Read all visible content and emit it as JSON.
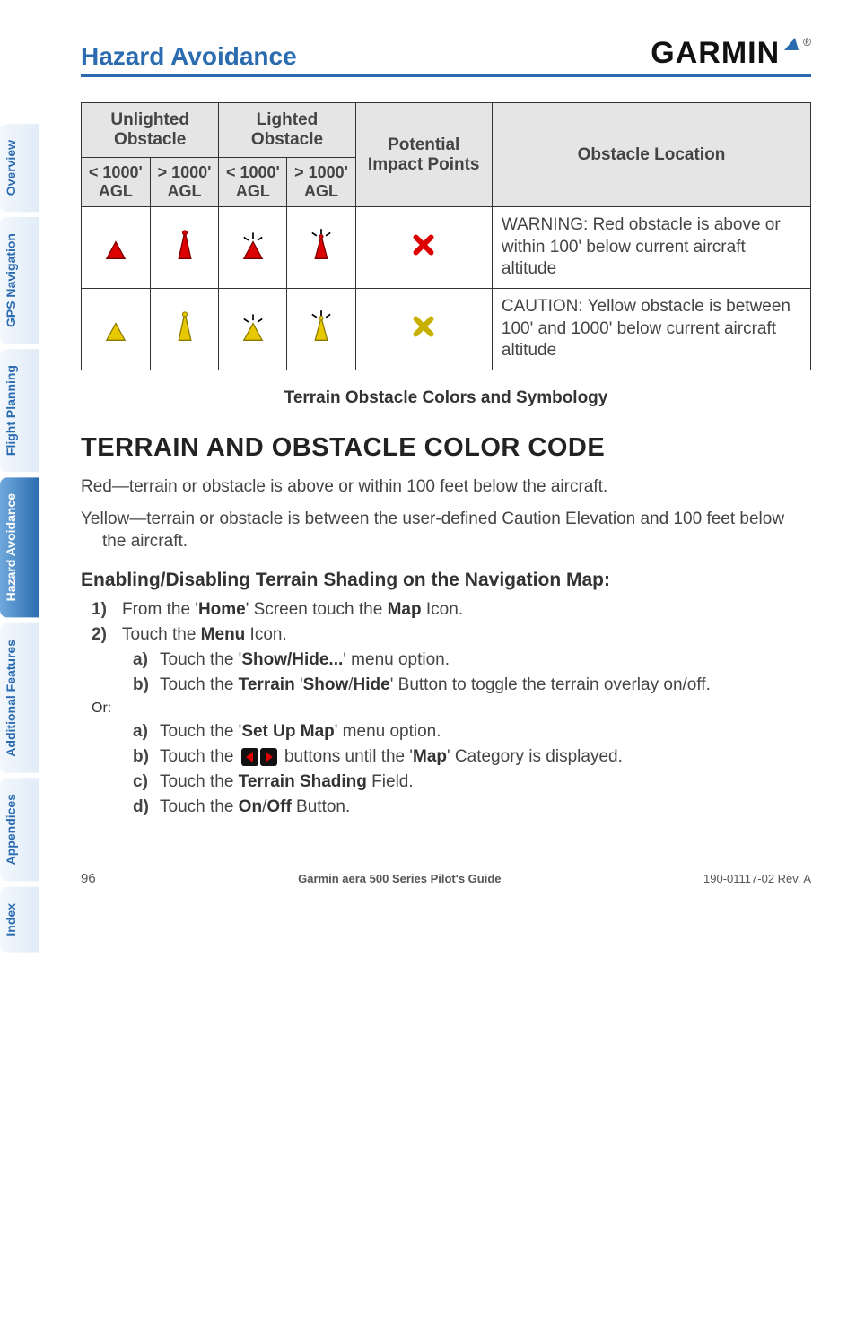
{
  "header": {
    "title": "Hazard Avoidance",
    "logo_text": "GARMIN"
  },
  "side_tabs": [
    {
      "label": "Overview"
    },
    {
      "label": "GPS Navigation"
    },
    {
      "label": "Flight Planning"
    },
    {
      "label": "Hazard Avoidance",
      "selected": true
    },
    {
      "label": "Additional Features"
    },
    {
      "label": "Appendices"
    },
    {
      "label": "Index"
    }
  ],
  "table_headers": {
    "unlighted": "Unlighted Obstacle",
    "lighted": "Lighted Obstacle",
    "lt1000": "< 1000' AGL",
    "gt1000": "> 1000' AGL",
    "potential": "Potential Impact Points",
    "location": "Obstacle Location"
  },
  "table_rows": [
    {
      "location": "WARNING: Red obstacle is above or within 100' below current aircraft altitude",
      "color": "red"
    },
    {
      "location": "CAUTION: Yellow obstacle is between 100' and 1000' below current aircraft altitude",
      "color": "yellow"
    }
  ],
  "caption": "Terrain Obstacle Colors and Symbology",
  "section_title": "TERRAIN AND OBSTACLE COLOR CODE",
  "paragraphs": {
    "red": "Red—terrain or obstacle is above or within 100 feet below the aircraft.",
    "yellow": "Yellow—terrain or obstacle is between the user-defined Caution Elevation and 100 feet below the aircraft."
  },
  "procedure": {
    "title": "Enabling/Disabling Terrain Shading on the Navigation Map:",
    "step1_num": "1)",
    "step1_pre": "From the '",
    "step1_b1": "Home",
    "step1_mid": "' Screen touch the ",
    "step1_b2": "Map",
    "step1_post": " Icon.",
    "step2_num": "2)",
    "step2_pre": "Touch the ",
    "step2_b": "Menu",
    "step2_post": " Icon.",
    "a1_num": "a)",
    "a1_pre": "Touch the '",
    "a1_b": "Show/Hide...",
    "a1_post": "' menu option.",
    "b1_num": "b)",
    "b1_pre": "Touch the ",
    "b1_b1": "Terrain",
    "b1_mid1": " '",
    "b1_b2": "Show",
    "b1_mid2": "/",
    "b1_b3": "Hide",
    "b1_post": "' Button to toggle the terrain overlay on/off.",
    "or": "Or:",
    "a2_num": "a)",
    "a2_pre": "Touch the '",
    "a2_b": "Set Up Map",
    "a2_post": "' menu option.",
    "b2_num": "b)",
    "b2_pre": "Touch the ",
    "b2_mid": " buttons until the '",
    "b2_b": "Map",
    "b2_post": "' Category is displayed.",
    "c_num": "c)",
    "c_pre": "Touch the ",
    "c_b": "Terrain Shading",
    "c_post": " Field.",
    "d_num": "d)",
    "d_pre": "Touch the ",
    "d_b1": "On",
    "d_mid": "/",
    "d_b2": "Off",
    "d_post": " Button."
  },
  "footer": {
    "page": "96",
    "mid": "Garmin aera 500 Series Pilot's Guide",
    "rev": "190-01117-02  Rev. A"
  }
}
